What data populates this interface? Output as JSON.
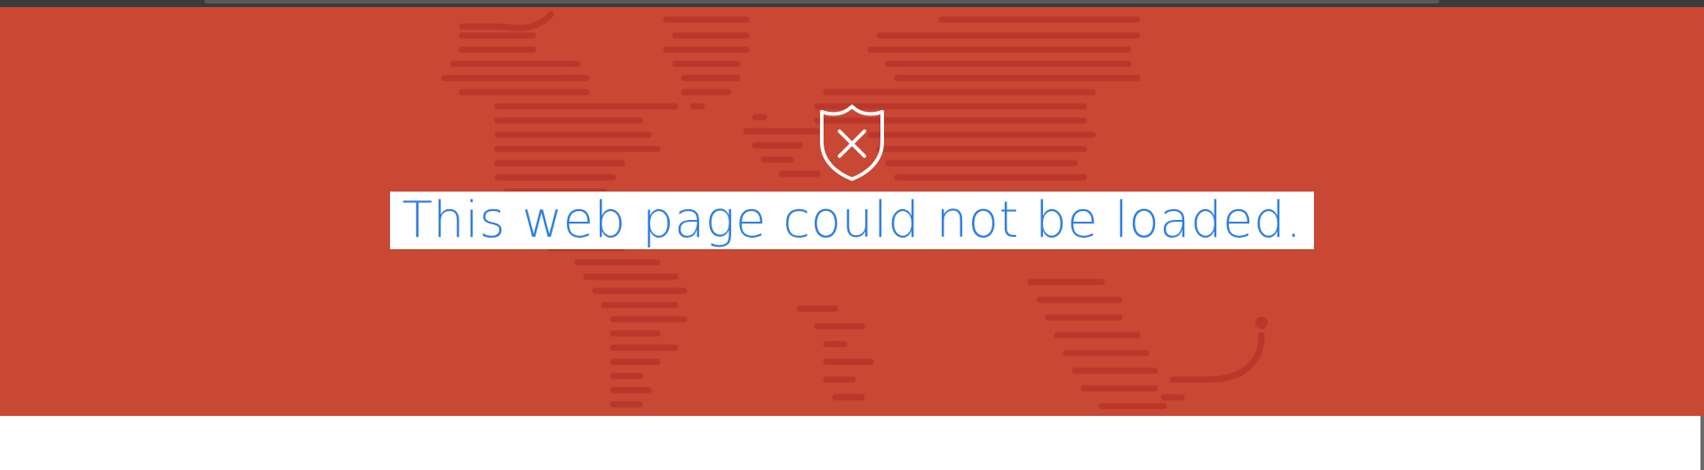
{
  "page": {
    "headline": "This web page could not be loaded.",
    "shield_icon": "shield-x-icon"
  },
  "colors": {
    "hero_background": "#c84834",
    "pattern_stroke": "#b8352a",
    "headline_text": "#2f7fe0",
    "headline_highlight": "#ffffff",
    "icon": "#ffffff"
  }
}
